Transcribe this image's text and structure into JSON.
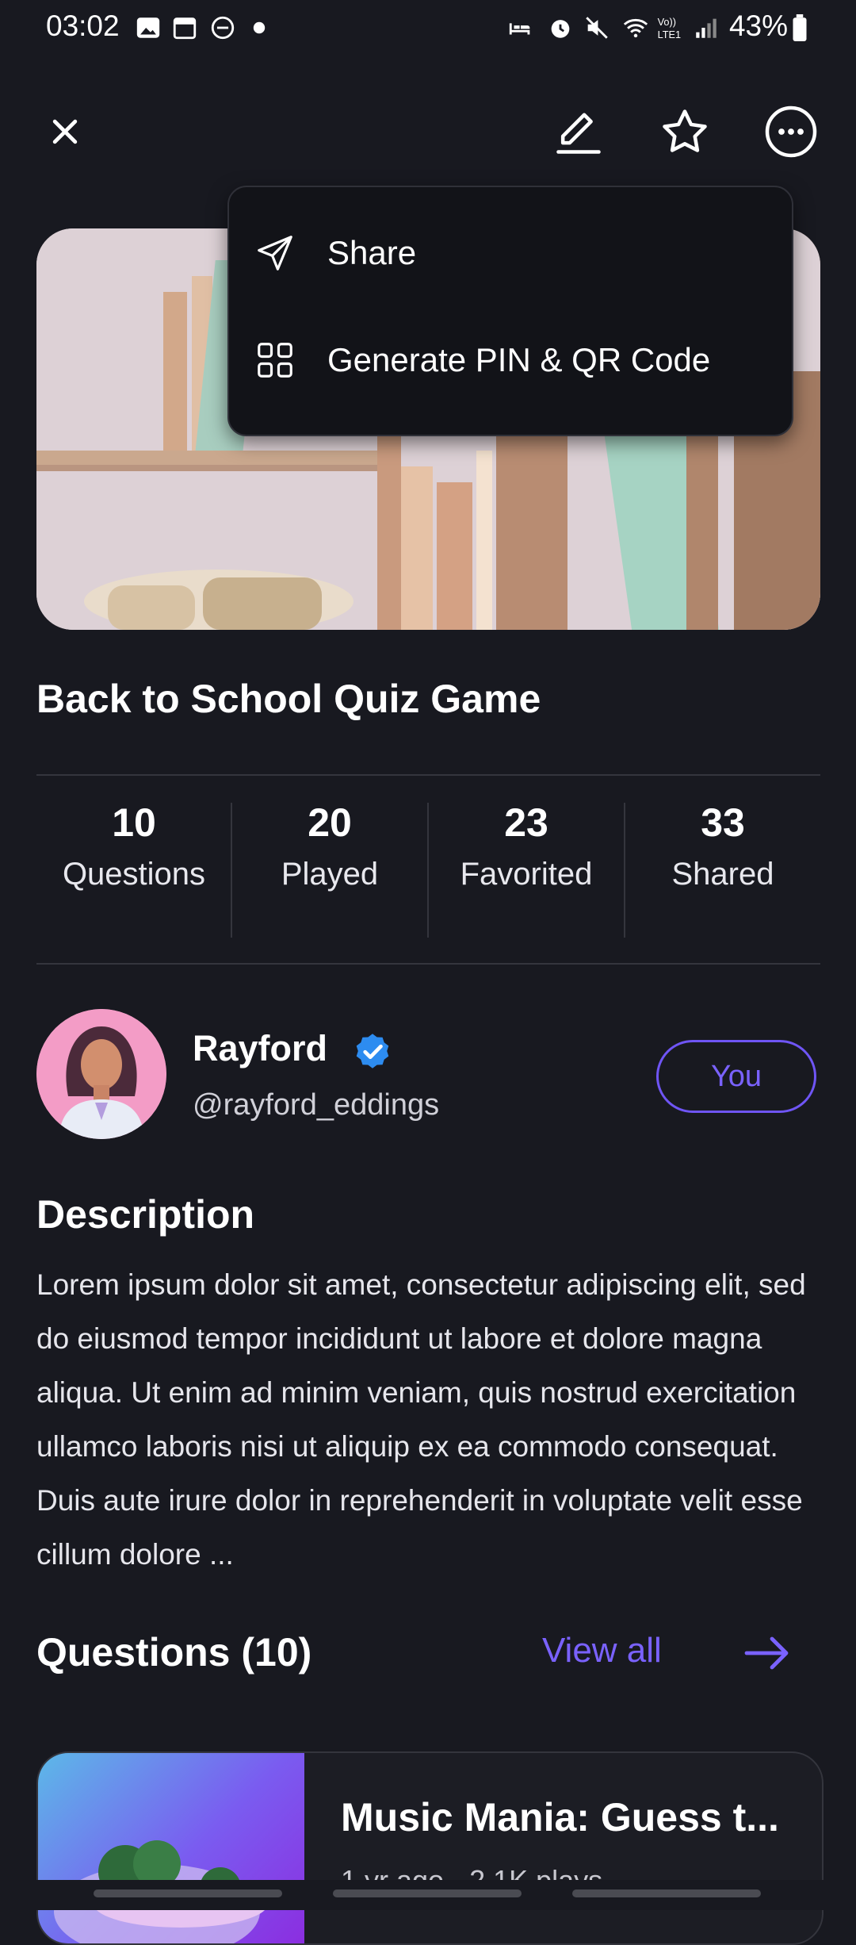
{
  "status_bar": {
    "time": "03:02",
    "battery": "43%"
  },
  "menu": {
    "items": [
      {
        "label": "Share",
        "icon": "send-icon"
      },
      {
        "label": "Generate PIN & QR Code",
        "icon": "grid-icon"
      }
    ]
  },
  "quiz": {
    "title": "Back to School Quiz Game",
    "stats": [
      {
        "value": "10",
        "label": "Questions"
      },
      {
        "value": "20",
        "label": "Played"
      },
      {
        "value": "23",
        "label": "Favorited"
      },
      {
        "value": "33",
        "label": "Shared"
      }
    ]
  },
  "author": {
    "name": "Rayford",
    "handle": "@rayford_eddings",
    "badge": "You"
  },
  "description": {
    "heading": "Description",
    "text": "Lorem ipsum dolor sit amet, consectetur adipiscing elit, sed do eiusmod tempor incididunt ut labore et dolore magna aliqua. Ut enim ad minim veniam, quis nostrud exercitation ullamco laboris nisi ut aliquip ex ea commodo consequat. Duis aute irure dolor in reprehenderit in voluptate velit esse cillum dolore ..."
  },
  "questions": {
    "heading": "Questions (10)",
    "view_all": "View all",
    "items": [
      {
        "title": "Music Mania: Guess t...",
        "meta": "1 yr ago · 2.1K plays"
      }
    ]
  },
  "colors": {
    "background": "#181920",
    "accent": "#6f55f5",
    "verified": "#2d8cf0"
  }
}
